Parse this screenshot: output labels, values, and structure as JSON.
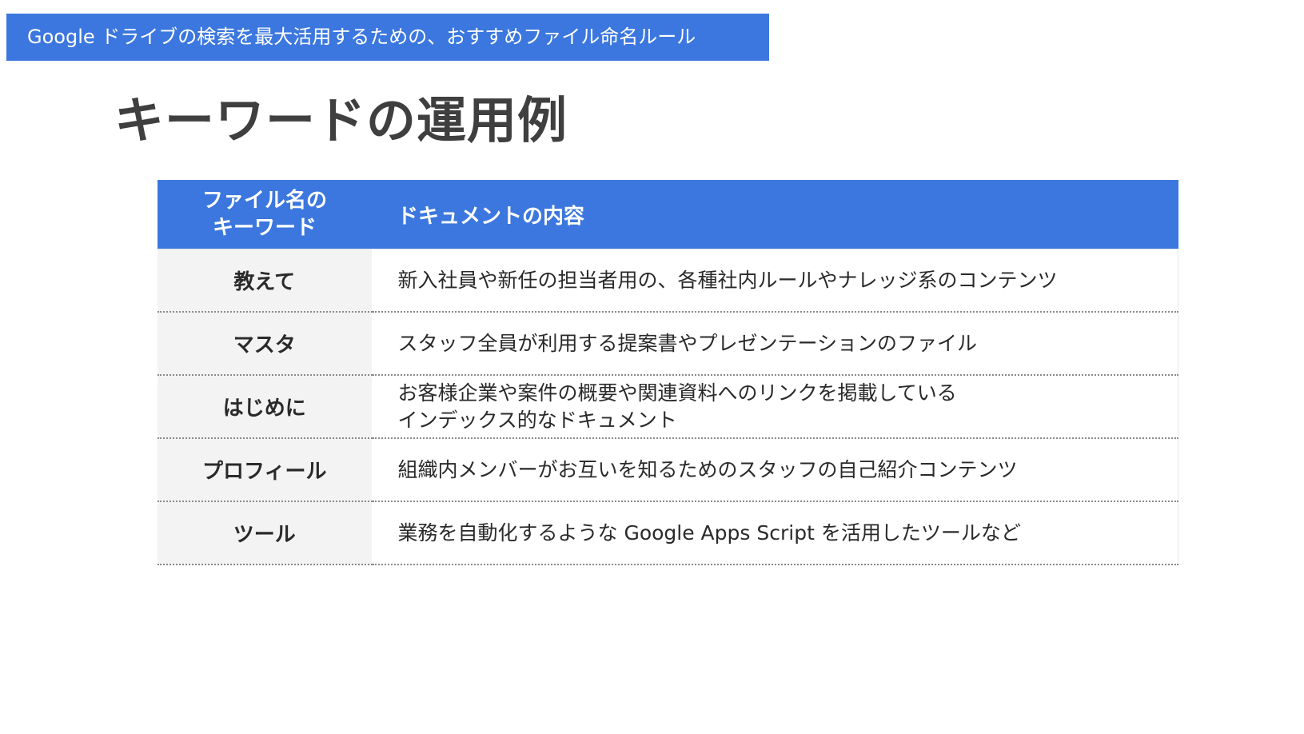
{
  "banner": {
    "text": "Google ドライブの検索を最大活用するための、おすすめファイル命名ルール"
  },
  "page_title": "キーワードの運用例",
  "table": {
    "headers": {
      "keyword": "ファイル名の\nキーワード",
      "content": "ドキュメントの内容"
    },
    "rows": [
      {
        "keyword": "教えて",
        "content": "新入社員や新任の担当者用の、各種社内ルールやナレッジ系のコンテンツ"
      },
      {
        "keyword": "マスタ",
        "content": "スタッフ全員が利用する提案書やプレゼンテーションのファイル"
      },
      {
        "keyword": "はじめに",
        "content": "お客様企業や案件の概要や関連資料へのリンクを掲載している\nインデックス的なドキュメント"
      },
      {
        "keyword": "プロフィール",
        "content": "組織内メンバーがお互いを知るためのスタッフの自己紹介コンテンツ"
      },
      {
        "keyword": "ツール",
        "content": "業務を自動化するような Google Apps Script を活用したツールなど"
      }
    ]
  },
  "colors": {
    "accent": "#3b77de",
    "title_text": "#3f3f3f",
    "keyword_cell_bg": "#f3f3f3"
  }
}
